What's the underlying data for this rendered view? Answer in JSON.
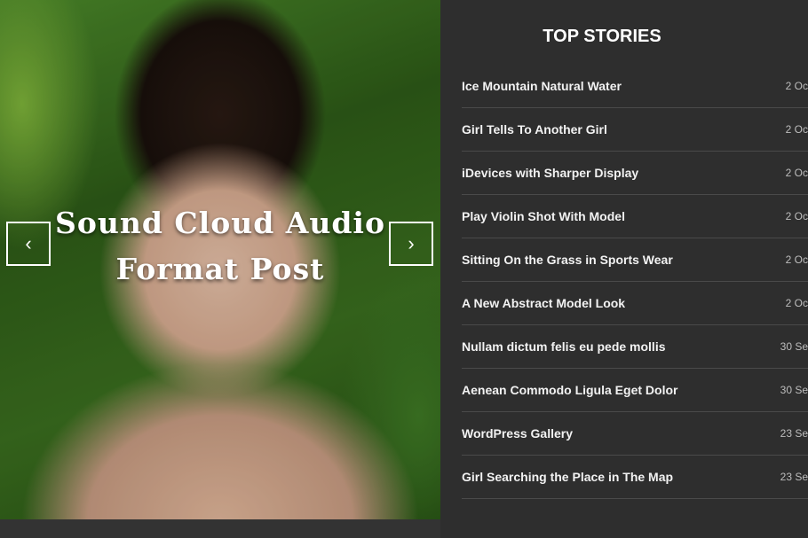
{
  "slider": {
    "title": "Sound Cloud Audio Format Post",
    "prev_icon": "‹",
    "next_icon": "›"
  },
  "top_stories": {
    "heading": "TOP STORIES",
    "items": [
      {
        "title": "Ice Mountain Natural Water",
        "date": "2 Oc"
      },
      {
        "title": "Girl Tells To Another Girl",
        "date": "2 Oc"
      },
      {
        "title": "iDevices with Sharper Display",
        "date": "2 Oc"
      },
      {
        "title": "Play Violin Shot With Model",
        "date": "2 Oc"
      },
      {
        "title": "Sitting On the Grass in Sports Wear",
        "date": "2 Oc"
      },
      {
        "title": "A New Abstract Model Look",
        "date": "2 Oc"
      },
      {
        "title": "Nullam dictum felis eu pede mollis",
        "date": "30 Se"
      },
      {
        "title": "Aenean Commodo Ligula Eget Dolor",
        "date": "30 Se"
      },
      {
        "title": "WordPress Gallery",
        "date": "23 Se"
      },
      {
        "title": "Girl Searching the Place in The Map",
        "date": "23 Se"
      }
    ]
  }
}
